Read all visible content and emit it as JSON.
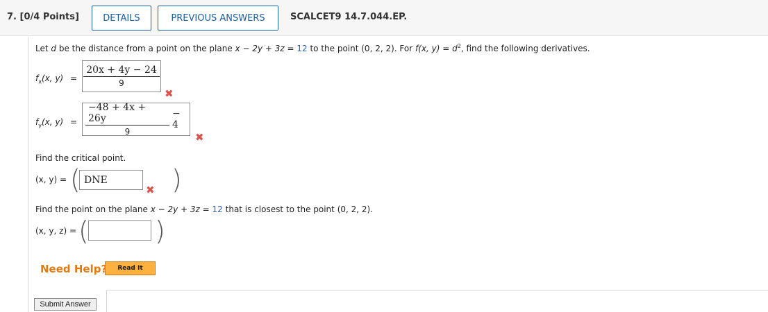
{
  "header": {
    "question_number": "7.",
    "points": "[0/4 Points]",
    "details_label": "DETAILS",
    "previous_answers_label": "PREVIOUS ANSWERS",
    "problem_code": "SCALCET9 14.7.044.EP."
  },
  "problem": {
    "text_prefix": "Let ",
    "var_d": "d",
    "text_mid1": " be the distance from a point on the plane ",
    "plane_lhs": "x − 2y + 3z = ",
    "plane_rhs": "12",
    "text_mid2": " to the point ",
    "point": "(0, 2, 2)",
    "text_mid3": ". For ",
    "f_def": "f(x, y) = d",
    "sup": "2",
    "text_end": ", find the following derivatives."
  },
  "fx": {
    "label_f": "f",
    "label_sub": "x",
    "label_args": "(x, y)",
    "equals": "=",
    "numerator": "20x + 4y − 24",
    "denominator": "9"
  },
  "fy": {
    "label_f": "f",
    "label_sub": "y",
    "label_args": "(x, y)",
    "equals": "=",
    "numerator": "−48 + 4x + 26y",
    "denominator": "9",
    "tail": "− 4"
  },
  "critical": {
    "prompt": "Find the critical point.",
    "label": "(x, y) =",
    "value": "DNE"
  },
  "closest": {
    "prompt_prefix": "Find the point on the plane ",
    "plane_lhs": "x − 2y + 3z = ",
    "plane_rhs": "12",
    "prompt_mid": " that is closest to the point ",
    "point": "(0, 2, 2)",
    "prompt_end": ".",
    "label": "(x, y, z) =",
    "value": ""
  },
  "help": {
    "need_help": "Need Help?",
    "read_it": "Read It"
  },
  "submit_label": "Submit Answer",
  "icons": {
    "incorrect": "x-mark-icon"
  },
  "colors": {
    "accent": "#1b5e9e",
    "link_blue": "#2a64b3",
    "incorrect_red": "#d9534f",
    "help_orange": "#e07b12",
    "read_it_bg": "#fbb040"
  }
}
